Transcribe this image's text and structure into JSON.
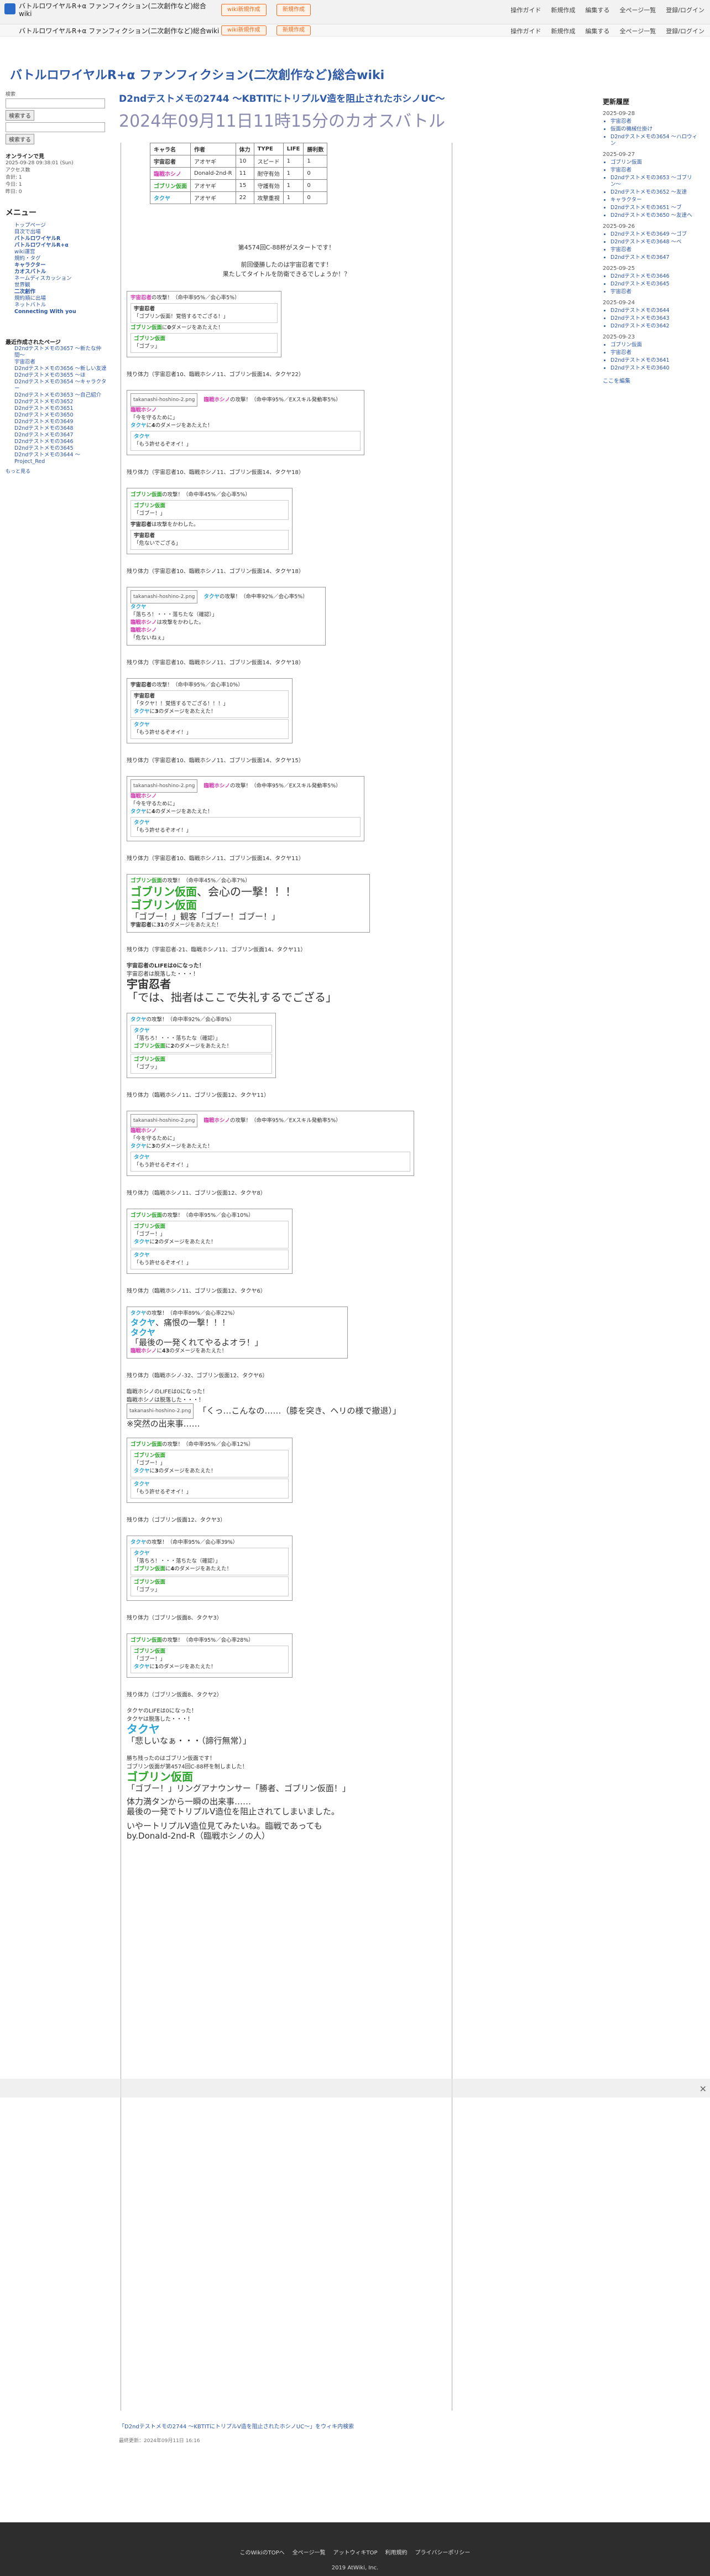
{
  "site": {
    "title": "バトルロワイヤルR+α ファンフィクション(二次創作など)総合wiki",
    "short_title": "バトルロワイヤルR+α ファンフィクション(二次創作など)総合wiki",
    "orange_button_1": "wiki新規作成",
    "orange_button_2": "新規作成"
  },
  "toolbar": {
    "items": [
      "操作ガイド",
      "新規作成",
      "編集する",
      "全ページ一覧",
      "登録/ログイン"
    ]
  },
  "sidebar_left": {
    "search_label": "検索",
    "search_button": "検索する",
    "search_button_2": "検索する",
    "online": "オンラインで見",
    "updated": "2025-09-28 09:38:01 (Sun)",
    "access_lines": [
      "アクセス数",
      "合計: 1",
      "今日: 1",
      "昨日: 0"
    ],
    "menu_heading": "メニュー",
    "menu": [
      {
        "label": "トップページ",
        "bold": false
      },
      {
        "label": "目次で出場",
        "bold": false
      },
      {
        "label": "バトルロワイヤルR",
        "bold": true
      },
      {
        "label": "バトルロワイヤルR+α",
        "bold": true
      },
      {
        "label": "wiki運営",
        "bold": false
      },
      {
        "label": "規約・タグ",
        "bold": false
      },
      {
        "label": "キャラクター",
        "bold": true
      },
      {
        "label": "カオスバトル",
        "bold": true
      },
      {
        "label": "ネームディスカッション",
        "bold": false
      },
      {
        "label": "世界観",
        "bold": false
      },
      {
        "label": "二次創作",
        "bold": true
      },
      {
        "label": "規約順に出場",
        "bold": false
      },
      {
        "label": "ネットバトル",
        "bold": false
      },
      {
        "label": "Connecting With you",
        "bold": true
      }
    ],
    "recent_heading": "最近作成されたページ",
    "recent": [
      "D2ndテストメモの3657 〜新たな仲間〜",
      "宇宙忍者",
      "D2ndテストメモの3656 〜新しい友達",
      "D2ndテストメモの3655 〜ほ",
      "D2ndテストメモの3654 〜キャラクター",
      "D2ndテストメモの3653 〜自己紹介",
      "D2ndテストメモの3652",
      "D2ndテストメモの3651",
      "D2ndテストメモの3650",
      "D2ndテストメモの3649",
      "D2ndテストメモの3648",
      "D2ndテストメモの3647",
      "D2ndテストメモの3646",
      "D2ndテストメモの3645",
      "D2ndテストメモの3644 〜Project_Red"
    ],
    "more": "もっと見る"
  },
  "sidebar_right": {
    "heading": "更新履歴",
    "groups": [
      {
        "date": "2025-09-28",
        "items": [
          "宇宙忍者",
          "仮面の機械仕掛け",
          "D2ndテストメモの3654 〜ハロウィン"
        ]
      },
      {
        "date": "2025-09-27",
        "items": [
          "ゴブリン仮面",
          "宇宙忍者",
          "D2ndテストメモの3653 〜ゴブリン〜",
          "D2ndテストメモの3652 〜友達",
          "キャラクター",
          "D2ndテストメモの3651 〜ブ",
          "D2ndテストメモの3650 〜友達へ"
        ]
      },
      {
        "date": "2025-09-26",
        "items": [
          "D2ndテストメモの3649 〜ゴブ",
          "D2ndテストメモの3648 〜ベ",
          "宇宙忍者",
          "D2ndテストメモの3647"
        ]
      },
      {
        "date": "2025-09-25",
        "items": [
          "D2ndテストメモの3646",
          "D2ndテストメモの3645",
          "宇宙忍者"
        ]
      },
      {
        "date": "2025-09-24",
        "items": [
          "D2ndテストメモの3644",
          "D2ndテストメモの3643",
          "D2ndテストメモの3642"
        ]
      },
      {
        "date": "2025-09-23",
        "items": [
          "ゴブリン仮面",
          "宇宙忍者",
          "D2ndテストメモの3641",
          "D2ndテストメモの3640"
        ]
      }
    ],
    "more": "ここを編集"
  },
  "page": {
    "h1": "D2ndテストメモの2744 〜KBTITにトリプルV造を阻止されたホシノUC〜",
    "subtitle": "2024年09月11日11時15分のカオスバトル",
    "cast_table": {
      "headers": [
        "キャラ名",
        "作者",
        "体力",
        "TYPE",
        "LIFE",
        "勝利数"
      ],
      "rows": [
        [
          "宇宙忍者",
          "アオヤギ",
          "10",
          "スピード",
          "1",
          "1"
        ],
        [
          "臨戦ホシノ",
          "Donald-2nd-R",
          "11",
          "耐守有効",
          "1",
          "0"
        ],
        [
          "ゴブリン仮面",
          "アオヤギ",
          "15",
          "守護有効",
          "1",
          "0"
        ],
        [
          "タクヤ",
          "アオヤギ",
          "22",
          "攻撃重視",
          "1",
          "0"
        ]
      ]
    },
    "intro": [
      "第4574回C-88杯がスタートです！",
      "前回優勝したのは宇宙忍者です！",
      "果たしてタイトルを防衛できるでしょうか！？"
    ],
    "image_alt": "takanashi-hoshino-2.png",
    "lines": [
      "残り体力（宇宙忍者10、臨戦ホシノ11、ゴブリン仮面14、タクヤ22）",
      "残り体力（宇宙忍者10、臨戦ホシノ11、ゴブリン仮面14、タクヤ18）",
      "残り体力（宇宙忍者10、臨戦ホシノ11、ゴブリン仮面14、タクヤ18）",
      "残り体力（宇宙忍者10、臨戦ホシノ11、ゴブリン仮面14、タクヤ18）",
      "残り体力（宇宙忍者10、臨戦ホシノ11、ゴブリン仮面14、タクヤ15）",
      "残り体力（宇宙忍者10、臨戦ホシノ11、ゴブリン仮面14、タクヤ11）",
      "残り体力（宇宙忍者-21、臨戦ホシノ11、ゴブリン仮面14、タクヤ11）",
      "残り体力（臨戦ホシノ11、ゴブリン仮面12、タクヤ11）",
      "残り体力（臨戦ホシノ11、ゴブリン仮面12、タクヤ8）",
      "残り体力（臨戦ホシノ11、ゴブリン仮面12、タクヤ6）",
      "残り体力（臨戦ホシノ-32、ゴブリン仮面12、タクヤ6）",
      "残り体力（ゴブリン仮面12、タクヤ3）",
      "残り体力（ゴブリン仮面8、タクヤ3）",
      "残り体力（ゴブリン仮面8、タクヤ2）"
    ],
    "retire_1": [
      "宇宙忍者のLIFEは0になった！",
      "宇宙忍者は脱落した・・・！"
    ],
    "retire_1_big": "宇宙忍者",
    "retire_1_quote": "「では、拙者はここで失礼するでござる」",
    "retire_2": [
      "臨戦ホシノのLIFEは0になった！",
      "臨戦ホシノは脱落した・・・！"
    ],
    "retire_2_quote": "「くっ…こんなの……（膝を突き、ヘリの様で撤退）」",
    "retire_2_note": "※突然の出来事……",
    "ending": [
      "タクヤのLIFEは0になった！",
      "タクヤは脱落した・・・！"
    ],
    "ending_big": "タクヤ",
    "ending_quote": "「悲しいなぁ・・・（諦行無常）」",
    "winner_lines": [
      "勝ち残ったのはゴブリン仮面です！",
      "ゴブリン仮面が第4574回C-88杯を制しました！"
    ],
    "winner_big": "ゴブリン仮面",
    "winner_quote": "「ゴブー！」リングアナウンサー「勝者、ゴブリン仮面！」",
    "closing": [
      "体力満タンから一瞬の出来事……",
      "最後の一発でトリプルV造位を阻止されてしまいました。",
      "いやートリプルV造位見てみたいね。臨戦であっても",
      "by.Donald-2nd-R（臨戦ホシノの人）"
    ],
    "footer_link": "「D2ndテストメモの2744 〜KBTITにトリプルV造を阻止されたホシノUC〜」をウィキ内検索",
    "last_update": "最終更新：2024年09月11日 16:16"
  },
  "footer": {
    "links": [
      "このWikiのTOPへ",
      "全ページ一覧",
      "アットウィキTOP",
      "利用規約",
      "プライバシーポリシー"
    ],
    "copy": "2019 AtWiki, Inc."
  }
}
